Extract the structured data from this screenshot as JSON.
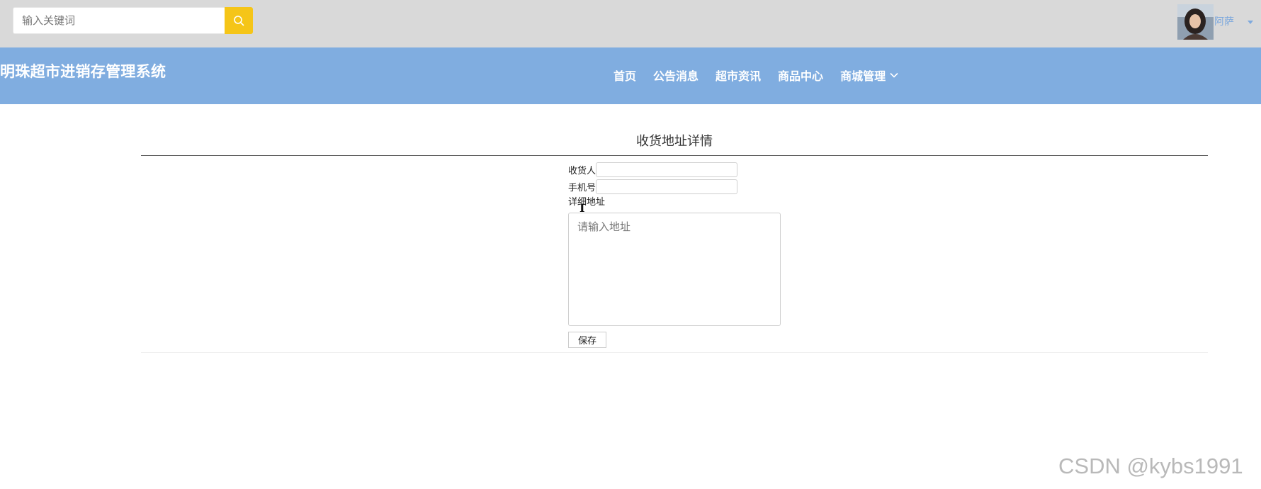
{
  "search": {
    "placeholder": "输入关键词"
  },
  "user": {
    "name": "阿萨"
  },
  "brand": {
    "title": "明珠超市进销存管理系统"
  },
  "nav": {
    "items": [
      {
        "label": "首页"
      },
      {
        "label": "公告消息"
      },
      {
        "label": "超市资讯"
      },
      {
        "label": "商品中心"
      },
      {
        "label": "商城管理"
      }
    ]
  },
  "page": {
    "title": "收货地址详情"
  },
  "form": {
    "receiver_label": "收货人",
    "receiver_value": "",
    "phone_label": "手机号",
    "phone_value": "",
    "address_label": "详细地址",
    "address_placeholder": "请输入地址",
    "save_label": "保存"
  },
  "watermark": "CSDN @kybs1991",
  "colors": {
    "topbar_bg": "#d9d9d9",
    "navbar_bg": "#80ade0",
    "search_button": "#f5c518",
    "username": "#7ea9dd"
  }
}
